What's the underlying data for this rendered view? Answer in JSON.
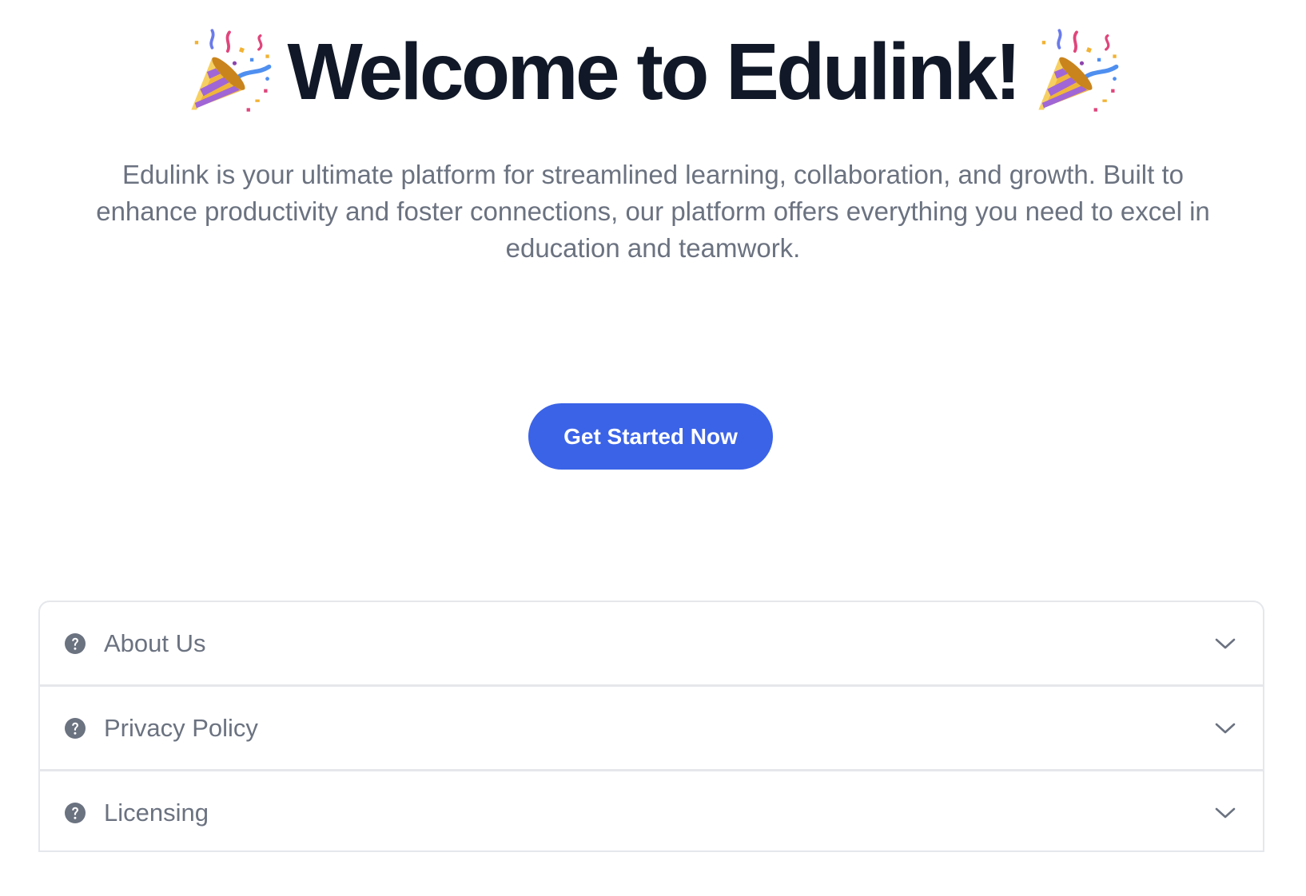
{
  "hero": {
    "title": "Welcome to Edulink!",
    "left_icon": "party-popper-icon",
    "right_icon": "party-popper-icon",
    "description": "Edulink is your ultimate platform for streamlined learning, collaboration, and growth. Built to enhance productivity and foster connections, our platform offers everything you need to excel in education and teamwork."
  },
  "cta": {
    "label": "Get Started Now",
    "color": "#3b63e7"
  },
  "accordion": {
    "items": [
      {
        "label": "About Us",
        "icon": "question-circle-icon",
        "toggle_icon": "chevron-down-icon"
      },
      {
        "label": "Privacy Policy",
        "icon": "question-circle-icon",
        "toggle_icon": "chevron-down-icon"
      },
      {
        "label": "Licensing",
        "icon": "question-circle-icon",
        "toggle_icon": "chevron-down-icon"
      }
    ]
  },
  "colors": {
    "title": "#111827",
    "text_muted": "#6b7280",
    "border": "#e5e7eb",
    "accent": "#3b63e7"
  }
}
